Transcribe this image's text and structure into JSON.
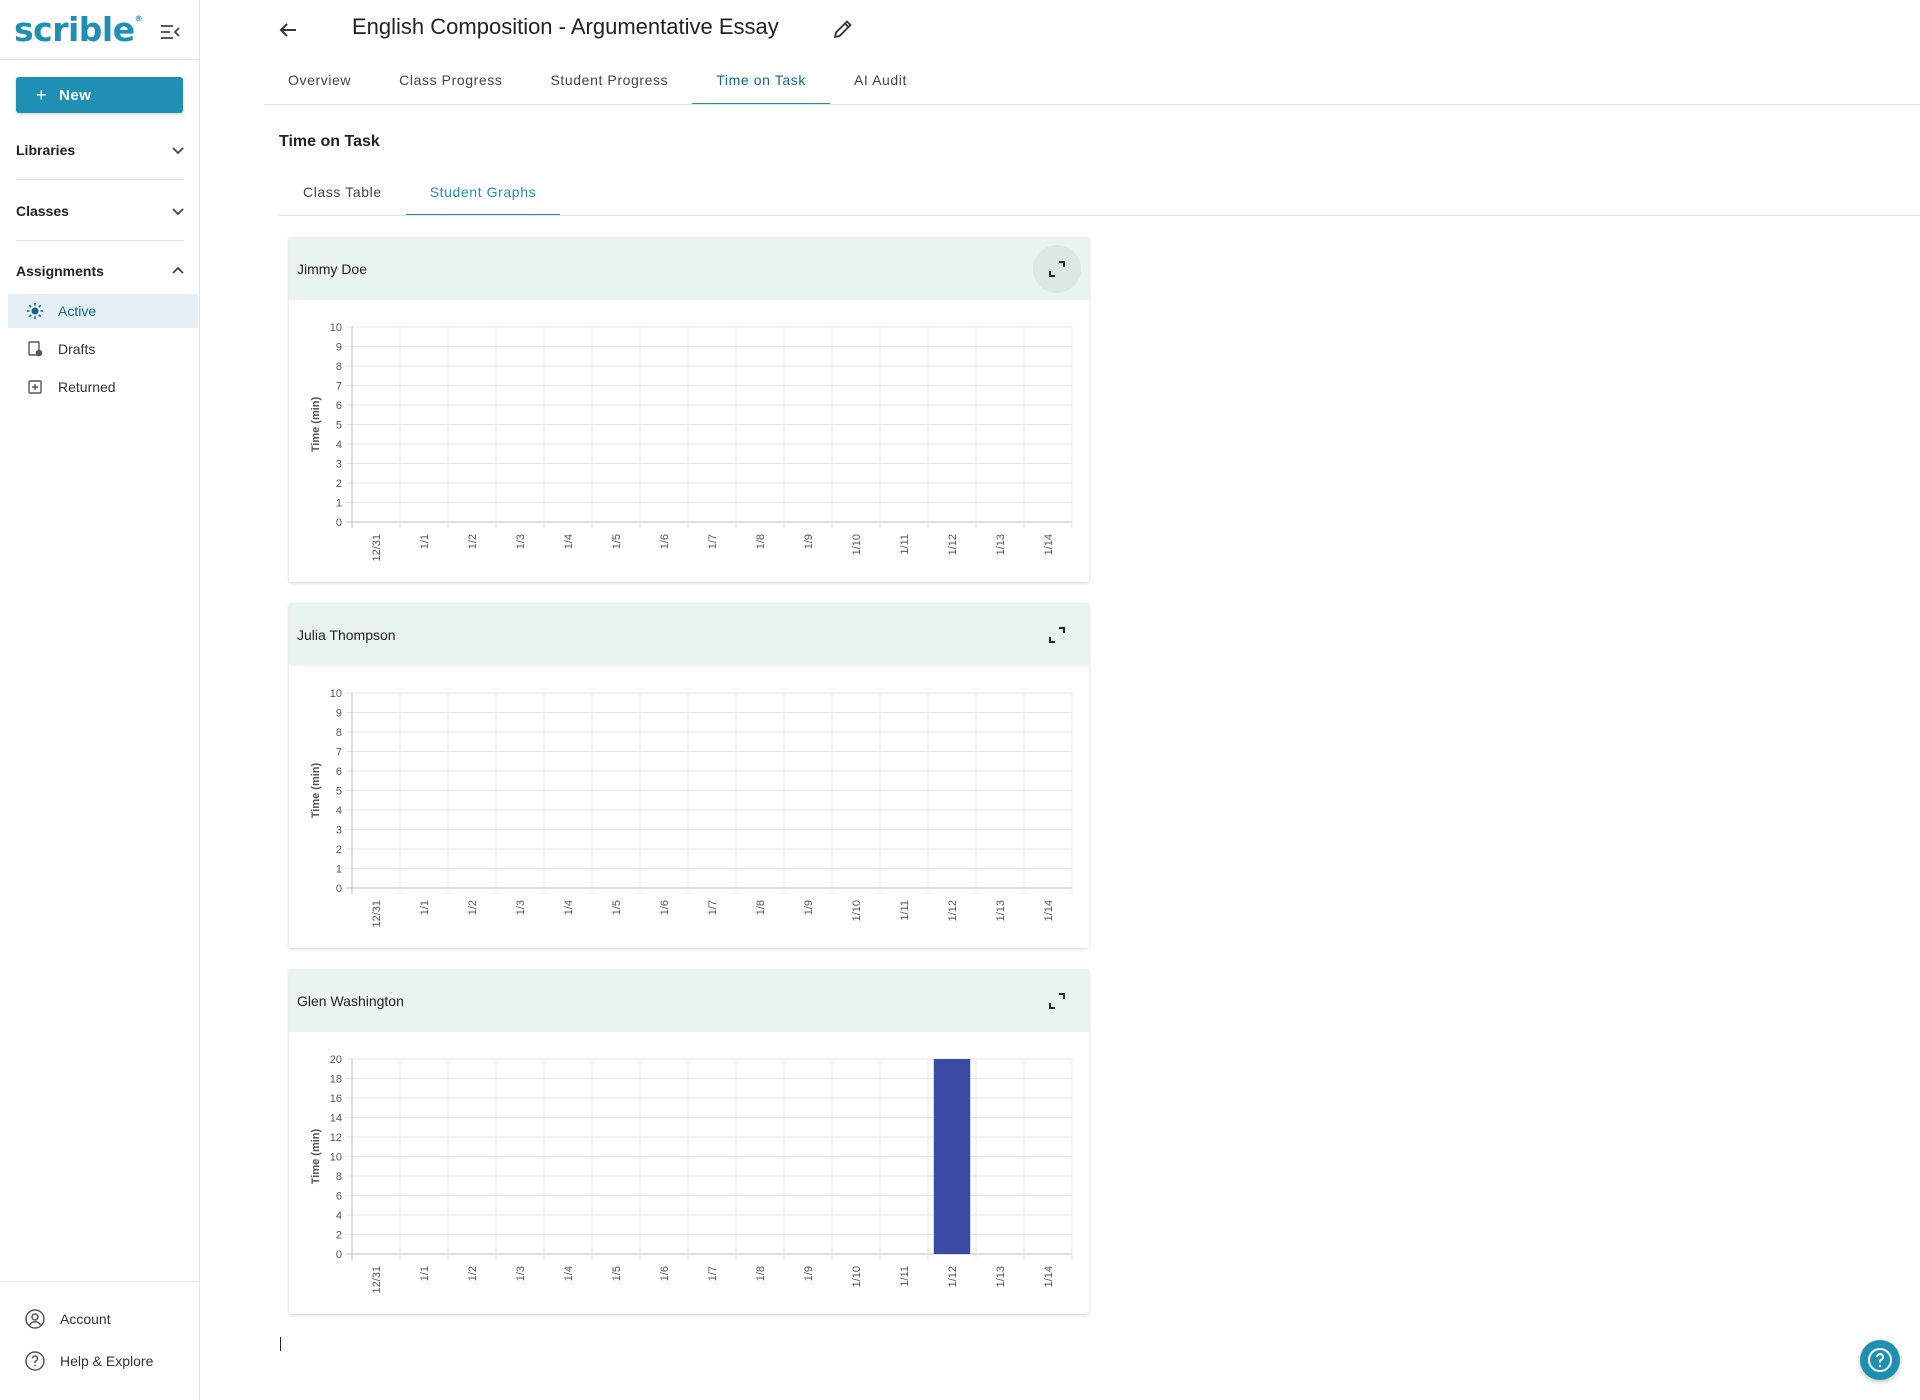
{
  "sidebar": {
    "logo": "scrible",
    "new_label": "New",
    "sections": {
      "libraries": "Libraries",
      "classes": "Classes",
      "assignments": "Assignments"
    },
    "items": [
      {
        "label": "Active",
        "icon": "sun-icon",
        "active": true
      },
      {
        "label": "Drafts",
        "icon": "draft-icon",
        "active": false
      },
      {
        "label": "Returned",
        "icon": "returned-icon",
        "active": false
      }
    ],
    "bottom": {
      "account": "Account",
      "help": "Help & Explore"
    }
  },
  "header": {
    "title": "English Composition - Argumentative Essay",
    "tabs": [
      "Overview",
      "Class Progress",
      "Student Progress",
      "Time on Task",
      "AI Audit"
    ],
    "active_tab": "Time on Task"
  },
  "main": {
    "section_title": "Time on Task",
    "subtabs": [
      "Class Table",
      "Student Graphs"
    ],
    "active_subtab": "Student Graphs"
  },
  "chart_data": [
    {
      "type": "bar",
      "title": "Jimmy Doe",
      "ylabel": "Time (min)",
      "categories": [
        "12/31",
        "1/1",
        "1/2",
        "1/3",
        "1/4",
        "1/5",
        "1/6",
        "1/7",
        "1/8",
        "1/9",
        "1/10",
        "1/11",
        "1/12",
        "1/13",
        "1/14"
      ],
      "values": [
        0,
        0,
        0,
        0,
        0,
        0,
        0,
        0,
        0,
        0,
        0,
        0,
        0,
        0,
        0
      ],
      "ylim": [
        0,
        10
      ],
      "yticks": [
        0,
        1,
        2,
        3,
        4,
        5,
        6,
        7,
        8,
        9,
        10
      ],
      "bar_color": "#3a4ba6",
      "grid": true
    },
    {
      "type": "bar",
      "title": "Julia Thompson",
      "ylabel": "Time (min)",
      "categories": [
        "12/31",
        "1/1",
        "1/2",
        "1/3",
        "1/4",
        "1/5",
        "1/6",
        "1/7",
        "1/8",
        "1/9",
        "1/10",
        "1/11",
        "1/12",
        "1/13",
        "1/14"
      ],
      "values": [
        0,
        0,
        0,
        0,
        0,
        0,
        0,
        0,
        0,
        0,
        0,
        0,
        0,
        0,
        0
      ],
      "ylim": [
        0,
        10
      ],
      "yticks": [
        0,
        1,
        2,
        3,
        4,
        5,
        6,
        7,
        8,
        9,
        10
      ],
      "bar_color": "#3a4ba6",
      "grid": true
    },
    {
      "type": "bar",
      "title": "Glen Washington",
      "ylabel": "Time (min)",
      "categories": [
        "12/31",
        "1/1",
        "1/2",
        "1/3",
        "1/4",
        "1/5",
        "1/6",
        "1/7",
        "1/8",
        "1/9",
        "1/10",
        "1/11",
        "1/12",
        "1/13",
        "1/14"
      ],
      "values": [
        0,
        0,
        0,
        0,
        0,
        0,
        0,
        0,
        0,
        0,
        0,
        0,
        20,
        0,
        0
      ],
      "ylim": [
        0,
        20
      ],
      "yticks": [
        0,
        2,
        4,
        6,
        8,
        10,
        12,
        14,
        16,
        18,
        20
      ],
      "bar_color": "#3a4ba6",
      "grid": true
    }
  ],
  "colors": {
    "accent": "#1f8fb4",
    "active_tab_text": "#14658a",
    "card_header_bg": "#e9f3ef",
    "active_nav_bg": "#e5f1f6"
  }
}
